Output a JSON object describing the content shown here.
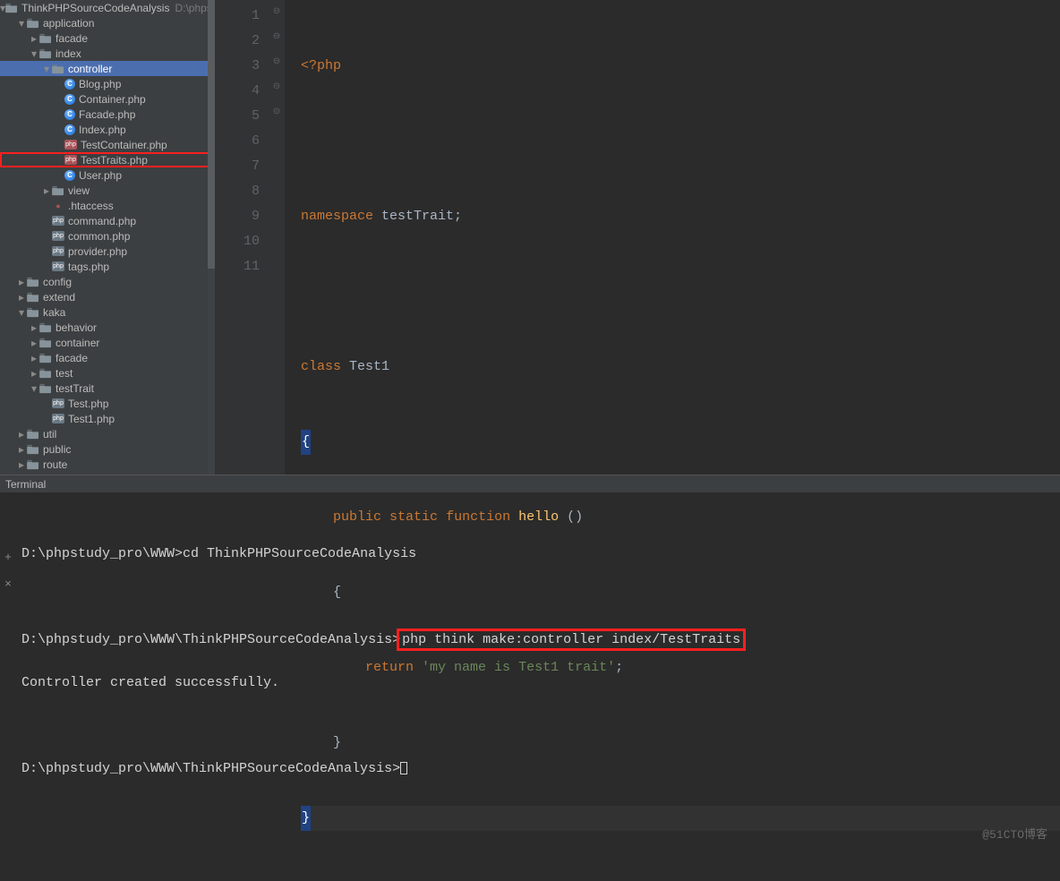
{
  "project": {
    "name": "ThinkPHPSourceCodeAnalysis",
    "path": "D:\\phpstudy"
  },
  "tree": [
    {
      "depth": 0,
      "arrow": "open",
      "icon": "folder",
      "label": "ThinkPHPSourceCodeAnalysis",
      "extra": "D:\\phpstudy"
    },
    {
      "depth": 1,
      "arrow": "open",
      "icon": "folder",
      "label": "application"
    },
    {
      "depth": 2,
      "arrow": "closed",
      "icon": "folder",
      "label": "facade"
    },
    {
      "depth": 2,
      "arrow": "open",
      "icon": "folder",
      "label": "index"
    },
    {
      "depth": 3,
      "arrow": "open",
      "icon": "folder",
      "label": "controller",
      "selected": true
    },
    {
      "depth": 4,
      "arrow": "none",
      "icon": "class",
      "label": "Blog.php"
    },
    {
      "depth": 4,
      "arrow": "none",
      "icon": "class",
      "label": "Container.php"
    },
    {
      "depth": 4,
      "arrow": "none",
      "icon": "class",
      "label": "Facade.php"
    },
    {
      "depth": 4,
      "arrow": "none",
      "icon": "class",
      "label": "Index.php"
    },
    {
      "depth": 4,
      "arrow": "none",
      "icon": "phpred",
      "label": "TestContainer.php"
    },
    {
      "depth": 4,
      "arrow": "none",
      "icon": "phpred",
      "label": "TestTraits.php",
      "highlight": true
    },
    {
      "depth": 4,
      "arrow": "none",
      "icon": "class",
      "label": "User.php"
    },
    {
      "depth": 3,
      "arrow": "closed",
      "icon": "folder",
      "label": "view"
    },
    {
      "depth": 3,
      "arrow": "none",
      "icon": "dotfile",
      "label": ".htaccess"
    },
    {
      "depth": 3,
      "arrow": "none",
      "icon": "php",
      "label": "command.php"
    },
    {
      "depth": 3,
      "arrow": "none",
      "icon": "php",
      "label": "common.php"
    },
    {
      "depth": 3,
      "arrow": "none",
      "icon": "php",
      "label": "provider.php"
    },
    {
      "depth": 3,
      "arrow": "none",
      "icon": "php",
      "label": "tags.php"
    },
    {
      "depth": 1,
      "arrow": "closed",
      "icon": "folder",
      "label": "config"
    },
    {
      "depth": 1,
      "arrow": "closed",
      "icon": "folder",
      "label": "extend"
    },
    {
      "depth": 1,
      "arrow": "open",
      "icon": "folder",
      "label": "kaka"
    },
    {
      "depth": 2,
      "arrow": "closed",
      "icon": "folder",
      "label": "behavior"
    },
    {
      "depth": 2,
      "arrow": "closed",
      "icon": "folder",
      "label": "container"
    },
    {
      "depth": 2,
      "arrow": "closed",
      "icon": "folder",
      "label": "facade"
    },
    {
      "depth": 2,
      "arrow": "closed",
      "icon": "folder",
      "label": "test"
    },
    {
      "depth": 2,
      "arrow": "open",
      "icon": "folder",
      "label": "testTrait"
    },
    {
      "depth": 3,
      "arrow": "none",
      "icon": "php",
      "label": "Test.php"
    },
    {
      "depth": 3,
      "arrow": "none",
      "icon": "php",
      "label": "Test1.php"
    },
    {
      "depth": 1,
      "arrow": "closed",
      "icon": "folder",
      "label": "util"
    },
    {
      "depth": 1,
      "arrow": "closed",
      "icon": "folder",
      "label": "public"
    },
    {
      "depth": 1,
      "arrow": "closed",
      "icon": "folder",
      "label": "route"
    }
  ],
  "editor": {
    "gutter": [
      "1",
      "2",
      "3",
      "4",
      "5",
      "6",
      "7",
      "8",
      "9",
      "10",
      "11"
    ],
    "fold": [
      "",
      "",
      "",
      "",
      "⊖",
      "⊖",
      "⊖",
      "",
      "",
      "⊝",
      "⊝"
    ],
    "current_line": 11
  },
  "code": {
    "php_open": "<?php",
    "ns_kw": "namespace",
    "ns_name": "testTrait",
    "semi": ";",
    "class_kw": "class",
    "class_name": "Test1",
    "lcurly": "{",
    "rcurly": "}",
    "public_kw": "public",
    "static_kw": "static",
    "function_kw": "function",
    "fn_name": "hello",
    "parens": "()",
    "return_kw": "return",
    "str": "'my name is Test1 trait'"
  },
  "terminal": {
    "tab": "Terminal",
    "line1_prompt": "D:\\phpstudy_pro\\WWW>",
    "line1_cmd": "cd ThinkPHPSourceCodeAnalysis",
    "line2_prompt": "D:\\phpstudy_pro\\WWW\\ThinkPHPSourceCodeAnalysis>",
    "line2_cmd": "php think make:controller index/TestTraits",
    "line3": "Controller created successfully.",
    "line4_prompt": "D:\\phpstudy_pro\\WWW\\ThinkPHPSourceCodeAnalysis>",
    "plus": "+",
    "x": "×"
  },
  "watermark": "@51CTO博客"
}
